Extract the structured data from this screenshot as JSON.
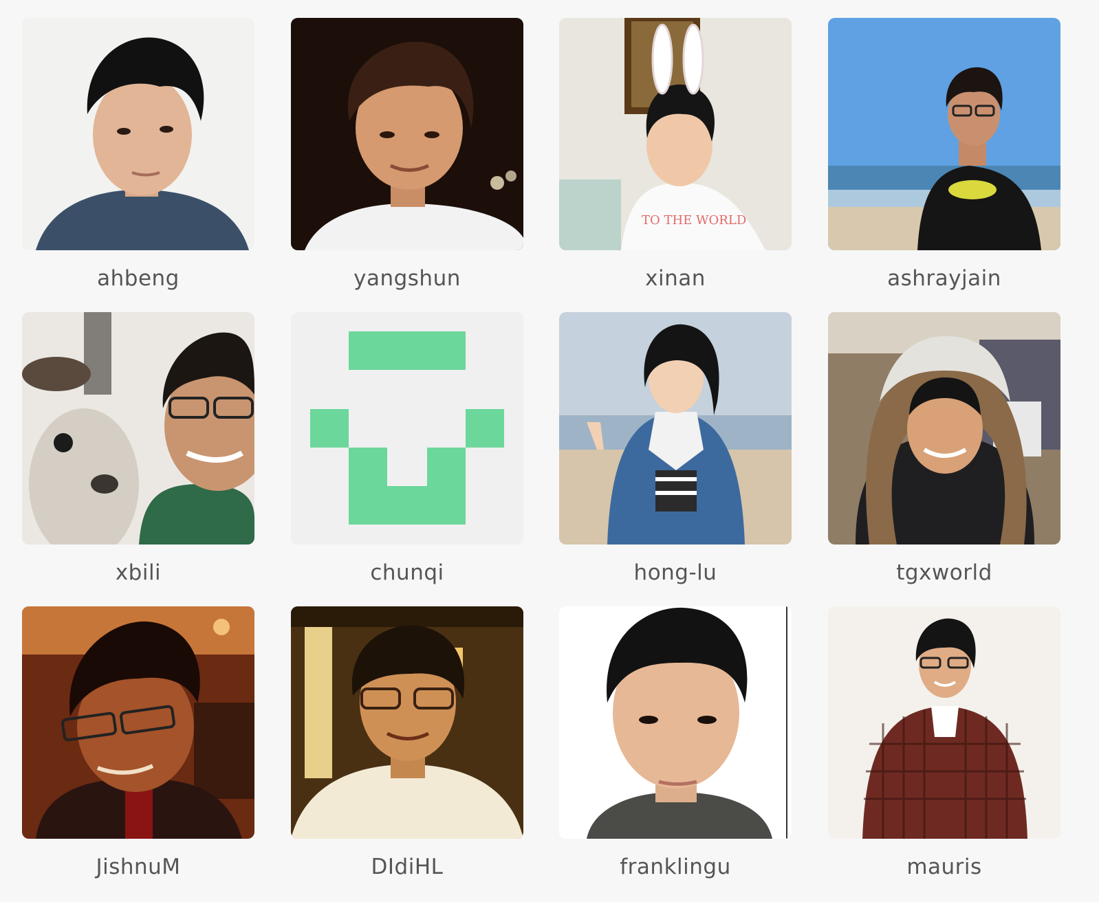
{
  "contributors": [
    {
      "username": "ahbeng",
      "avatar_icon": "person-photo-icon",
      "bg": "#eaeaea"
    },
    {
      "username": "yangshun",
      "avatar_icon": "person-photo-icon",
      "bg": "#1a0d08"
    },
    {
      "username": "xinan",
      "avatar_icon": "person-photo-icon",
      "bg": "#e6e4dc"
    },
    {
      "username": "ashrayjain",
      "avatar_icon": "person-photo-icon",
      "bg": "#5b9de0"
    },
    {
      "username": "xbili",
      "avatar_icon": "person-photo-icon",
      "bg": "#e9e6e2"
    },
    {
      "username": "chunqi",
      "avatar_icon": "identicon-icon",
      "bg": "#f0f0f0",
      "accent": "#6cd79b"
    },
    {
      "username": "hong-lu",
      "avatar_icon": "person-photo-icon",
      "bg": "#b9c7d5"
    },
    {
      "username": "tgxworld",
      "avatar_icon": "person-photo-icon",
      "bg": "#7a5c40"
    },
    {
      "username": "JishnuM",
      "avatar_icon": "person-photo-icon",
      "bg": "#6e2a10"
    },
    {
      "username": "DIdiHL",
      "avatar_icon": "person-photo-icon",
      "bg": "#4a3010"
    },
    {
      "username": "franklingu",
      "avatar_icon": "person-photo-icon",
      "bg": "#ffffff"
    },
    {
      "username": "mauris",
      "avatar_icon": "person-photo-icon",
      "bg": "#f5f2ee"
    }
  ]
}
